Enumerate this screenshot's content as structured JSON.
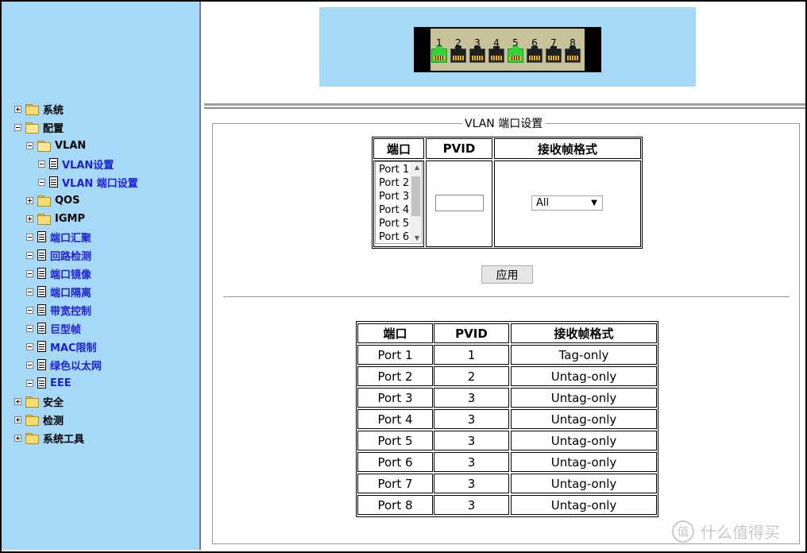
{
  "sidebar": {
    "system": "系统",
    "config": "配置",
    "vlan": "VLAN",
    "vlan_settings": "VLAN设置",
    "vlan_port_settings": "VLAN 端口设置",
    "qos": "QOS",
    "igmp": "IGMP",
    "port_trunk": "端口汇聚",
    "loop_detect": "回路检测",
    "port_mirror": "端口镜像",
    "port_isolation": "端口隔离",
    "bandwidth": "带宽控制",
    "jumbo": "巨型帧",
    "mac_limit": "MAC限制",
    "green_ethernet": "绿色以太网",
    "eee": "EEE",
    "security": "安全",
    "detect": "检测",
    "tools": "系统工具"
  },
  "switch_panel": {
    "ports": [
      "1",
      "2",
      "3",
      "4",
      "5",
      "6",
      "7",
      "8"
    ],
    "link_up": [
      true,
      false,
      false,
      false,
      true,
      false,
      false,
      false
    ]
  },
  "form": {
    "legend": "VLAN 端口设置",
    "col_port": "端口",
    "col_pvid": "PVID",
    "col_frame": "接收帧格式",
    "port_options": [
      "Port 1",
      "Port 2",
      "Port 3",
      "Port 4",
      "Port 5",
      "Port 6"
    ],
    "pvid_value": "",
    "frame_selected": "All",
    "apply": "应用"
  },
  "table": {
    "headers": [
      "端口",
      "PVID",
      "接收帧格式"
    ],
    "rows": [
      [
        "Port 1",
        "1",
        "Tag-only"
      ],
      [
        "Port 2",
        "2",
        "Untag-only"
      ],
      [
        "Port 3",
        "3",
        "Untag-only"
      ],
      [
        "Port 4",
        "3",
        "Untag-only"
      ],
      [
        "Port 5",
        "3",
        "Untag-only"
      ],
      [
        "Port 6",
        "3",
        "Untag-only"
      ],
      [
        "Port 7",
        "3",
        "Untag-only"
      ],
      [
        "Port 8",
        "3",
        "Untag-only"
      ]
    ]
  },
  "watermark": {
    "logo": "值",
    "text": "什么值得买"
  }
}
